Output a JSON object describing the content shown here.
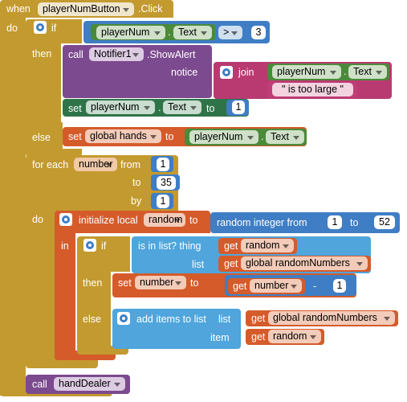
{
  "event": {
    "when": "when",
    "component": "playerNumButton",
    "event": ".Click",
    "do": "do",
    "colors": {
      "control": "#c39a2f",
      "text": "#4b8a39",
      "number": "#3f7ec4"
    }
  },
  "if1": {
    "if": "if",
    "then": "then",
    "else": "else",
    "component": "playerNum",
    "property": "Text",
    "operator": ">",
    "value": "3"
  },
  "alert": {
    "call": "call",
    "component": "Notifier1",
    "method": ".ShowAlert",
    "notice": "notice",
    "join": "join",
    "join_component": "playerNum",
    "join_property": "Text",
    "string": "\" is too large \""
  },
  "set_playernum": {
    "set": "set",
    "component": "playerNum",
    "property": "Text",
    "to": "to",
    "value": "1"
  },
  "set_hands": {
    "set": "set",
    "variable": "global hands",
    "to": "to",
    "component": "playerNum",
    "property": "Text"
  },
  "for_each": {
    "for_each": "for each",
    "variable": "number",
    "from": "from",
    "from_value": "1",
    "to": "to",
    "to_value": "35",
    "by": "by",
    "by_value": "1",
    "do": "do"
  },
  "init_local": {
    "label": "initialize local",
    "variable": "random",
    "to": "to",
    "random_label": "random integer from",
    "from_value": "1",
    "to_label": "to",
    "to_value": "52",
    "in": "in"
  },
  "if2": {
    "if": "if",
    "is_in_list": "is in list? thing",
    "get1": "get",
    "get1_var": "random",
    "list": "list",
    "get2": "get",
    "get2_var": "global randomNumbers",
    "then": "then",
    "else": "else"
  },
  "set_number": {
    "set": "set",
    "variable": "number",
    "to": "to",
    "get": "get",
    "get_var": "number",
    "op": "-",
    "value": "1"
  },
  "add_items": {
    "label": "add items to list",
    "list": "list",
    "get1": "get",
    "get1_var": "global randomNumbers",
    "item": "item",
    "get2": "get",
    "get2_var": "random"
  },
  "call_hand": {
    "call": "call",
    "procedure": "handDealer"
  }
}
